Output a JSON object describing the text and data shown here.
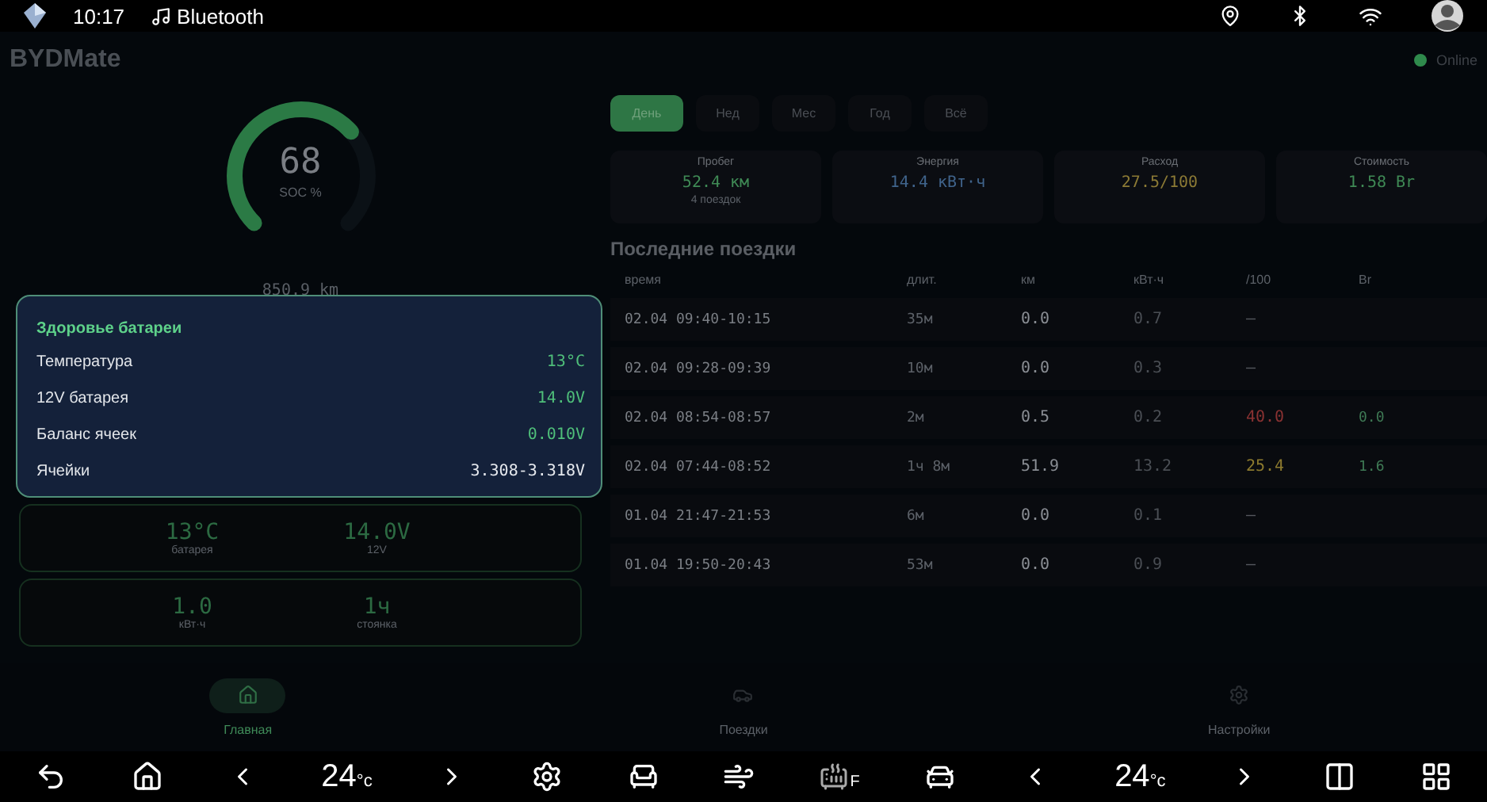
{
  "status_bar": {
    "time": "10:17",
    "media": "Bluetooth"
  },
  "app": {
    "title": "BYDMate",
    "connection": {
      "label": "Online",
      "online": true
    }
  },
  "gauge": {
    "value": "68",
    "label": "SOC %"
  },
  "range": "850.9 km",
  "battery_health": {
    "title": "Здоровье батареи",
    "rows": [
      {
        "label": "Температура",
        "value": "13°C",
        "color": "#4fbf7a"
      },
      {
        "label": "12V батарея",
        "value": "14.0V",
        "color": "#4fbf7a"
      },
      {
        "label": "Баланс ячеек",
        "value": "0.010V",
        "color": "#4fbf7a"
      },
      {
        "label": "Ячейки",
        "value": "3.308-3.318V",
        "color": "#e6e9ee"
      }
    ]
  },
  "mini_cards": [
    {
      "items": [
        {
          "value": "13°C",
          "label": "батарея"
        },
        {
          "value": "14.0V",
          "label": "12V"
        }
      ]
    },
    {
      "items": [
        {
          "value": "1.0",
          "label": "кВт·ч"
        },
        {
          "value": "1ч",
          "label": "стоянка"
        }
      ]
    }
  ],
  "period_tabs": [
    {
      "label": "День",
      "selected": true
    },
    {
      "label": "Нед",
      "selected": false
    },
    {
      "label": "Мес",
      "selected": false
    },
    {
      "label": "Год",
      "selected": false
    },
    {
      "label": "Всё",
      "selected": false
    }
  ],
  "summary": [
    {
      "label": "Пробег",
      "value": "52.4 км",
      "note": "4 поездок",
      "color": "#3f8a55"
    },
    {
      "label": "Энергия",
      "value": "14.4 кВт·ч",
      "color": "#40648c"
    },
    {
      "label": "Расход",
      "value": "27.5/100",
      "color": "#8c7a35"
    },
    {
      "label": "Стоимость",
      "value": "1.58 Br",
      "color": "#3f8a55"
    }
  ],
  "recent_trips": {
    "title": "Последние поездки",
    "columns": [
      "время",
      "длит.",
      "км",
      "кВт·ч",
      "/100",
      "Br"
    ],
    "rows": [
      {
        "time": "02.04 09:40-10:15",
        "duration": "35м",
        "distance": "0.0",
        "energy": "0.7",
        "consumption": "—",
        "color": "#55585e"
      },
      {
        "time": "02.04 09:28-09:39",
        "duration": "10м",
        "distance": "0.0",
        "energy": "0.3",
        "consumption": "—",
        "color": "#55585e"
      },
      {
        "time": "02.04 08:54-08:57",
        "duration": "2м",
        "distance": "0.5",
        "energy": "0.2",
        "consumption": "40.0",
        "cost": "0.0",
        "color": "#8a3232"
      },
      {
        "time": "02.04 07:44-08:52",
        "duration": "1ч 8м",
        "distance": "51.9",
        "energy": "13.2",
        "consumption": "25.4",
        "cost": "1.6",
        "color": "#8c7a2e"
      },
      {
        "time": "01.04 21:47-21:53",
        "duration": "6м",
        "distance": "0.0",
        "energy": "0.1",
        "consumption": "—",
        "color": "#55585e"
      },
      {
        "time": "01.04 19:50-20:43",
        "duration": "53м",
        "distance": "0.0",
        "energy": "0.9",
        "consumption": "—",
        "color": "#55585e"
      }
    ]
  },
  "bottom_nav": [
    {
      "label": "Главная",
      "selected": true
    },
    {
      "label": "Поездки",
      "selected": false
    },
    {
      "label": "Настройки",
      "selected": false
    }
  ],
  "car_bar": {
    "left_temp": "24",
    "left_unit": "°c",
    "right_temp": "24",
    "right_unit": "°c",
    "defrost_mark": "F"
  }
}
